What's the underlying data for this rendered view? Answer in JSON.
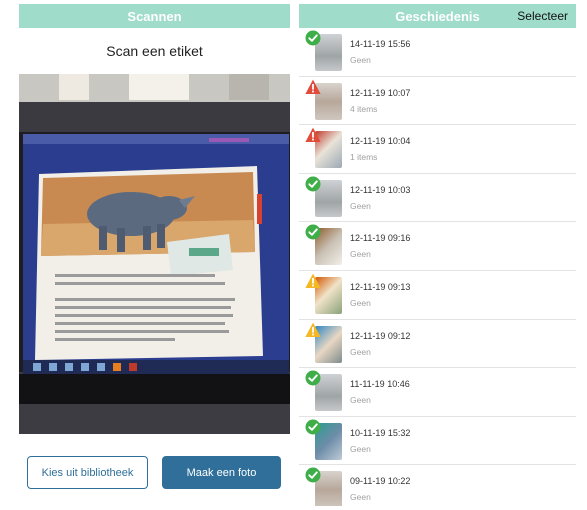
{
  "scan_panel": {
    "tab_title": "Scannen",
    "heading": "Scan een etiket",
    "library_button": "Kies uit bibliotheek",
    "photo_button": "Maak een foto"
  },
  "history_panel": {
    "tab_title": "Geschiedenis",
    "select_label": "Selecteer",
    "items": [
      {
        "date": "14-11-19 15:56",
        "status": "Geen",
        "badge": "check-icon",
        "thumb": "thumb-a"
      },
      {
        "date": "12-11-19 10:07",
        "status": "4 items",
        "badge": "error-icon",
        "thumb": "thumb-b"
      },
      {
        "date": "12-11-19 10:04",
        "status": "1 items",
        "badge": "error-icon",
        "thumb": "thumb-c"
      },
      {
        "date": "12-11-19 10:03",
        "status": "Geen",
        "badge": "check-icon",
        "thumb": "thumb-a"
      },
      {
        "date": "12-11-19 09:16",
        "status": "Geen",
        "badge": "check-icon",
        "thumb": "thumb-g"
      },
      {
        "date": "12-11-19 09:13",
        "status": "Geen",
        "badge": "warning-icon",
        "thumb": "thumb-d"
      },
      {
        "date": "12-11-19 09:12",
        "status": "Geen",
        "badge": "warning-icon",
        "thumb": "thumb-e"
      },
      {
        "date": "11-11-19 10:46",
        "status": "Geen",
        "badge": "check-icon",
        "thumb": "thumb-a"
      },
      {
        "date": "10-11-19 15:32",
        "status": "Geen",
        "badge": "check-icon",
        "thumb": "thumb-f"
      },
      {
        "date": "09-11-19 10:22",
        "status": "Geen",
        "badge": "check-icon",
        "thumb": "thumb-b"
      }
    ]
  },
  "colors": {
    "header": "#9fdcc9",
    "primary_button": "#2f6f99",
    "success": "#3fae49",
    "error": "#e04b3a",
    "warning": "#f3b823"
  }
}
